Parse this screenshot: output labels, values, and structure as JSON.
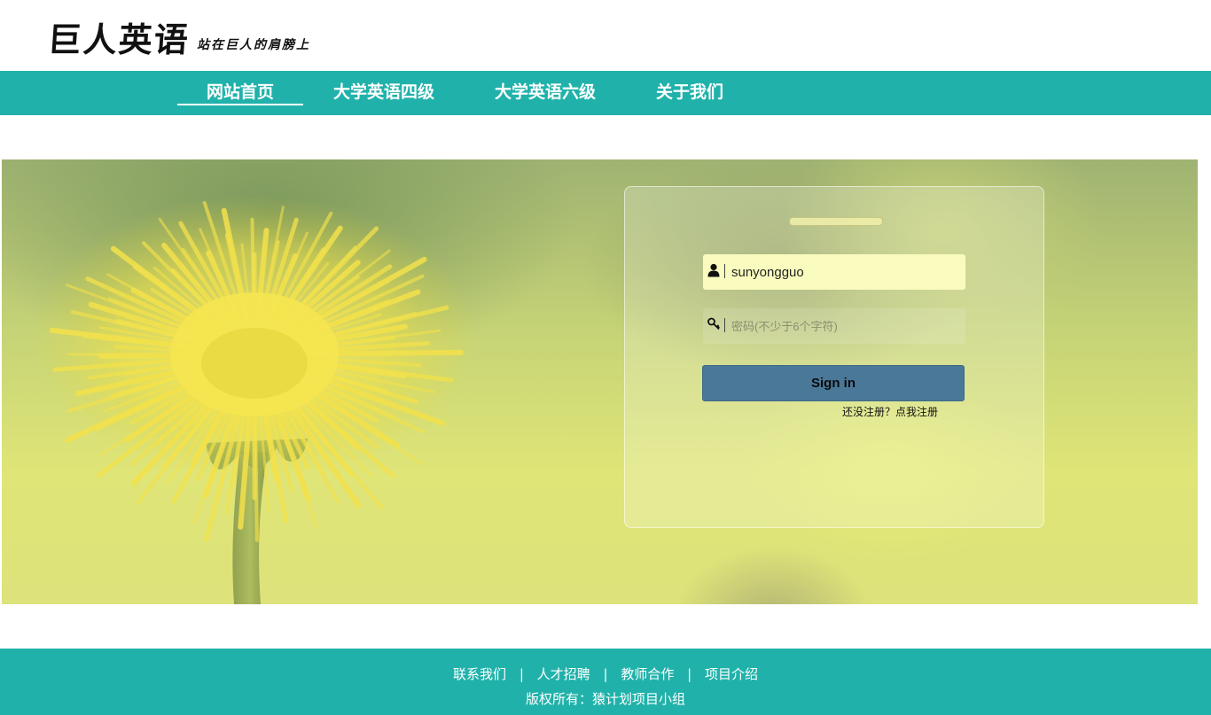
{
  "header": {
    "logo_text": "巨人英语",
    "slogan": "站在巨人的肩膀上"
  },
  "nav": {
    "items": [
      {
        "label": "网站首页",
        "active": true
      },
      {
        "label": "大学英语四级",
        "active": false
      },
      {
        "label": "大学英语六级",
        "active": false
      },
      {
        "label": "关于我们",
        "active": false
      }
    ]
  },
  "login": {
    "username_value": "sunyongguo",
    "password_placeholder": "密码(不少于6个字符)",
    "signin_label": "Sign in",
    "register_text": "还没注册？点我注册",
    "username_icon": "user-icon",
    "password_icon": "key-icon"
  },
  "footer": {
    "links": [
      "联系我们",
      "人才招聘",
      "教师合作",
      "项目介绍"
    ],
    "separator": "|",
    "copyright": "版权所有：猿计划项目小组"
  },
  "colors": {
    "brand_teal": "#20b2aa",
    "signin_button": "#4a7898",
    "username_field": "#fafcbf"
  }
}
